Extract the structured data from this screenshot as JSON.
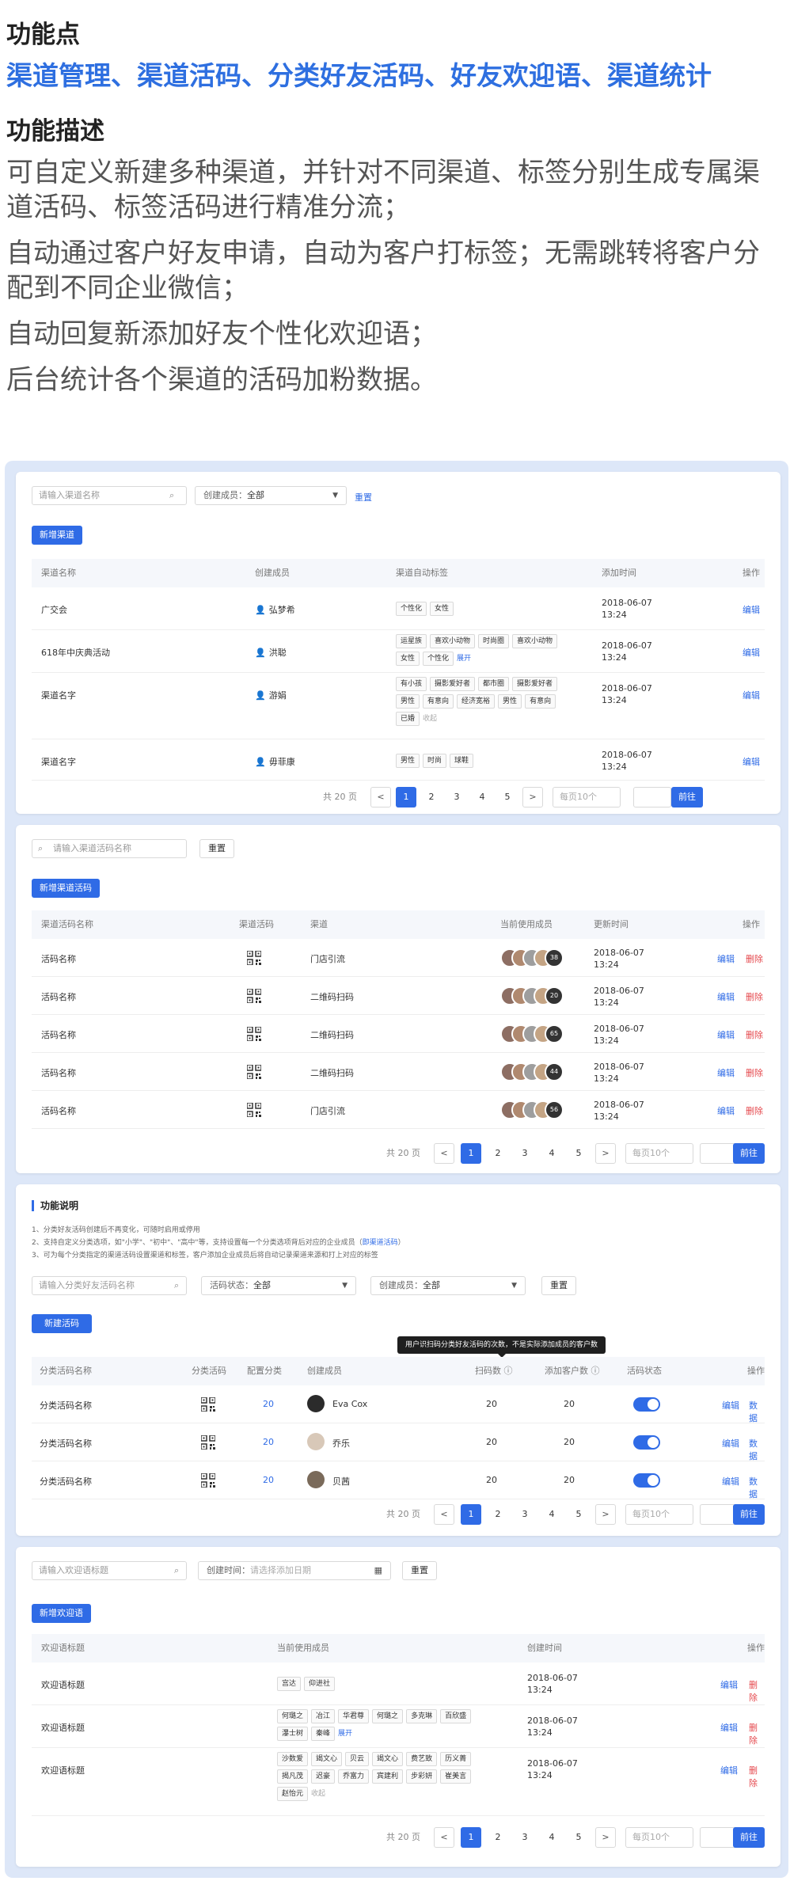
{
  "hero": {
    "title1": "功能点",
    "features": "渠道管理、渠道活码、分类好友活码、好友欢迎语、渠道统计",
    "title2": "功能描述",
    "descs": [
      "可自定义新建多种渠道，并针对不同渠道、标签分别生成专属渠道活码、标签活码进行精准分流；",
      "自动通过客户好友申请，自动为客户打标签；无需跳转将客户分配到不同企业微信；",
      "自动回复新添加好友个性化欢迎语；",
      "后台统计各个渠道的活码加粉数据。"
    ]
  },
  "colors": {
    "primary": "#2f6be6",
    "danger": "#e5484d",
    "bg": "#dde7f8"
  },
  "pager": {
    "total": "共 20 页",
    "prev": "<",
    "next": ">",
    "pages": [
      "1",
      "2",
      "3",
      "4",
      "5"
    ],
    "page_size": "每页10个",
    "go": "前往"
  },
  "channel": {
    "search_placeholder": "请输入渠道名称",
    "creator_label": "创建成员：",
    "creator_value": "全部",
    "reset": "重置",
    "new_btn": "新增渠道",
    "headers": [
      "渠道名称",
      "创建成员",
      "渠道自动标签",
      "添加时间",
      "操作"
    ],
    "rows": [
      {
        "name": "广交会",
        "creator": "弘梦希",
        "tags": [
          [
            "个性化",
            "女性"
          ]
        ],
        "more": "",
        "date": "2018-06-07",
        "time": "13:24",
        "action": "编辑"
      },
      {
        "name": "618年中庆典活动",
        "creator": "洪聪",
        "tags": [
          [
            "运星族",
            "喜欢小动物",
            "时尚圈",
            "喜欢小动物"
          ],
          [
            "女性",
            "个性化"
          ]
        ],
        "more": "展开",
        "date": "2018-06-07",
        "time": "13:24",
        "action": "编辑"
      },
      {
        "name": "渠道名字",
        "creator": "游娟",
        "tags": [
          [
            "有小孩",
            "摄影爱好者",
            "都市圈",
            "摄影爱好者"
          ],
          [
            "男性",
            "有意向",
            "经济宽裕",
            "男性",
            "有意向"
          ],
          [
            "已婚"
          ]
        ],
        "more": "收起",
        "date": "2018-06-07",
        "time": "13:24",
        "action": "编辑"
      },
      {
        "name": "渠道名字",
        "creator": "毋菲康",
        "tags": [
          [
            "男性",
            "时尚",
            "球鞋"
          ]
        ],
        "more": "",
        "date": "2018-06-07",
        "time": "13:24",
        "action": "编辑"
      }
    ]
  },
  "livecode": {
    "search_placeholder": "请输入渠道活码名称",
    "reset": "重置",
    "new_btn": "新增渠道活码",
    "headers": [
      "渠道活码名称",
      "渠道活码",
      "渠道",
      "当前使用成员",
      "更新时间",
      "操作"
    ],
    "rows": [
      {
        "name": "活码名称",
        "channel": "门店引流",
        "count": "38",
        "date": "2018-06-07",
        "time": "13:24",
        "edit": "编辑",
        "del": "删除"
      },
      {
        "name": "活码名称",
        "channel": "二维码扫码",
        "count": "20",
        "date": "2018-06-07",
        "time": "13:24",
        "edit": "编辑",
        "del": "删除"
      },
      {
        "name": "活码名称",
        "channel": "二维码扫码",
        "count": "65",
        "date": "2018-06-07",
        "time": "13:24",
        "edit": "编辑",
        "del": "删除"
      },
      {
        "name": "活码名称",
        "channel": "二维码扫码",
        "count": "44",
        "date": "2018-06-07",
        "time": "13:24",
        "edit": "编辑",
        "del": "删除"
      },
      {
        "name": "活码名称",
        "channel": "门店引流",
        "count": "56",
        "date": "2018-06-07",
        "time": "13:24",
        "edit": "编辑",
        "del": "删除"
      }
    ]
  },
  "category": {
    "note_title": "功能说明",
    "notes": [
      "1、分类好友活码创建后不再变化，可随时启用或停用",
      "2、支持自定义分类选项，如\"小学\"、\"初中\"、\"高中\"等，支持设置每一个分类选项背后对应的企业成员（",
      "3、可为每个分类指定的渠道活码设置渠道和标签，客户添加企业成员后将自动记录渠道来源和打上对应的标签"
    ],
    "note_link": "即渠道活码",
    "note_tail": "）",
    "search_placeholder": "请输入分类好友活码名称",
    "status_label": "活码状态：",
    "status_value": "全部",
    "creator_label": "创建成员：",
    "creator_value": "全部",
    "reset": "重置",
    "new_btn": "新建活码",
    "tooltip": "用户识扫码分类好友活码的次数，不是实际添加成员的客户数",
    "headers": [
      "分类活码名称",
      "分类活码",
      "配置分类",
      "创建成员",
      "扫码数",
      "添加客户数",
      "活码状态",
      "操作"
    ],
    "rows": [
      {
        "name": "分类活码名称",
        "config": "20",
        "creator": "Eva Cox",
        "scans": "20",
        "customers": "20",
        "edit": "编辑",
        "data": "数据"
      },
      {
        "name": "分类活码名称",
        "config": "20",
        "creator": "乔乐",
        "scans": "20",
        "customers": "20",
        "edit": "编辑",
        "data": "数据"
      },
      {
        "name": "分类活码名称",
        "config": "20",
        "creator": "贝茜",
        "scans": "20",
        "customers": "20",
        "edit": "编辑",
        "data": "数据"
      }
    ]
  },
  "welcome": {
    "search_placeholder": "请输入欢迎语标题",
    "time_label": "创建时间：",
    "time_placeholder": "请选择添加日期",
    "reset": "重置",
    "new_btn": "新增欢迎语",
    "headers": [
      "欢迎语标题",
      "当前使用成员",
      "创建时间",
      "操作"
    ],
    "rows": [
      {
        "title": "欢迎语标题",
        "members": [
          [
            "宫达",
            "仰进社"
          ]
        ],
        "more": "",
        "date": "2018-06-07",
        "time": "13:24",
        "edit": "编辑",
        "del": "删除"
      },
      {
        "title": "欢迎语标题",
        "members": [
          [
            "何璐之",
            "冶江",
            "华君尊",
            "何璐之",
            "多克琳",
            "百欣盛"
          ],
          [
            "瀑士树",
            "秦峰"
          ]
        ],
        "more": "展开",
        "date": "2018-06-07",
        "time": "13:24",
        "edit": "编辑",
        "del": "删除"
      },
      {
        "title": "欢迎语标题",
        "members": [
          [
            "沙数爱",
            "竭文心",
            "贝云",
            "竭文心",
            "费艺致",
            "历义菁"
          ],
          [
            "揭凡茂",
            "迟豪",
            "乔富力",
            "宾建利",
            "步彩妍",
            "崔美言"
          ],
          [
            "赵怡元"
          ]
        ],
        "more": "收起",
        "date": "2018-06-07",
        "time": "13:24",
        "edit": "编辑",
        "del": "删除"
      }
    ]
  }
}
